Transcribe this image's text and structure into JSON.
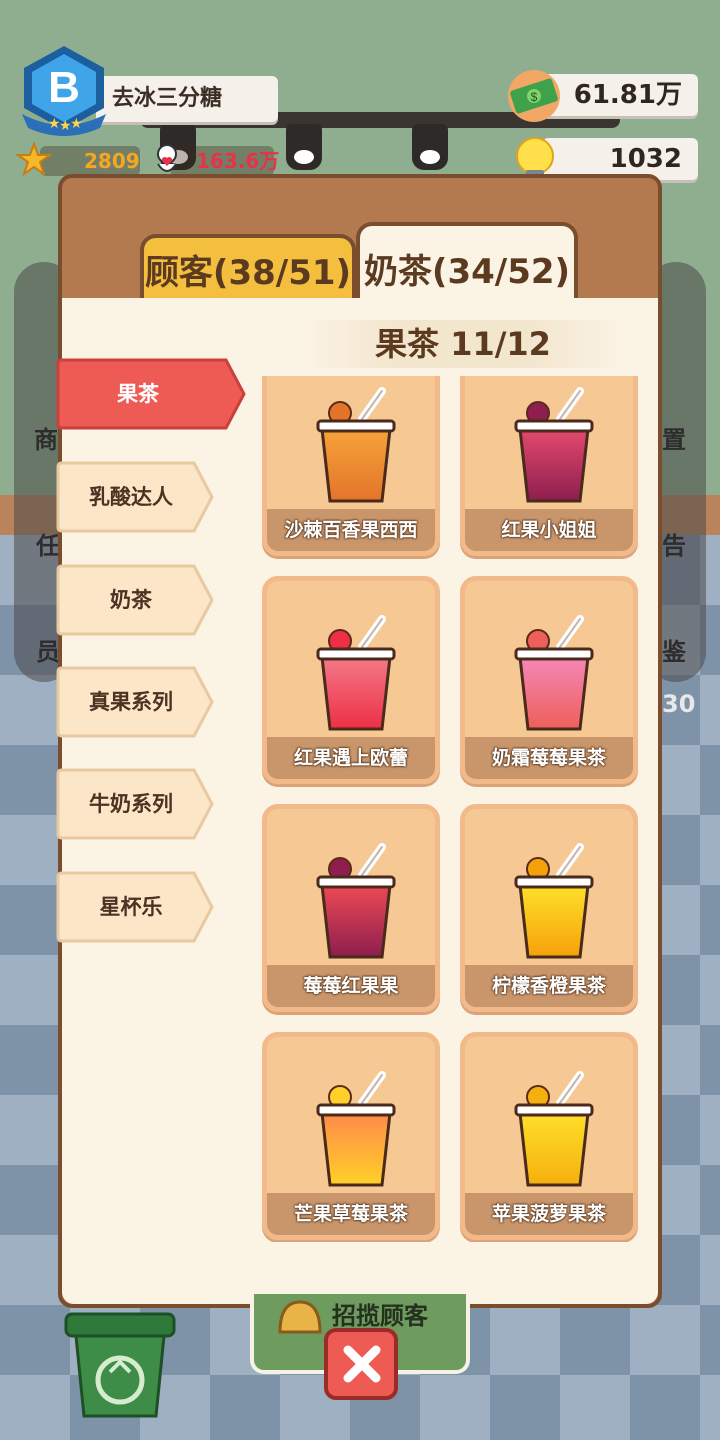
{
  "player": {
    "rank": "B",
    "name": "去冰三分糖",
    "stars": "2809",
    "popularity": "163.6万"
  },
  "currency": {
    "money": "61.81万",
    "ideas": "1032"
  },
  "side_menu_left": [
    "商",
    "任",
    "员"
  ],
  "side_menu_right": [
    "置",
    "告",
    "鉴"
  ],
  "floor_number": "30",
  "banner_text": "招揽顾客",
  "tabs": [
    {
      "label": "顾客(38/51)",
      "active": false
    },
    {
      "label": "奶茶(34/52)",
      "active": true
    }
  ],
  "category_header": "果茶 11/12",
  "categories": [
    {
      "label": "果茶",
      "active": true
    },
    {
      "label": "乳酸达人",
      "active": false
    },
    {
      "label": "奶茶",
      "active": false
    },
    {
      "label": "真果系列",
      "active": false
    },
    {
      "label": "牛奶系列",
      "active": false
    },
    {
      "label": "星杯乐",
      "active": false
    }
  ],
  "drinks": [
    {
      "name": "沙棘百香果西西",
      "icon": "seabuckthorn-drink-icon",
      "color_top": "#f6a33a",
      "color_bottom": "#e3742a"
    },
    {
      "name": "红果小姐姐",
      "icon": "red-fruit-drink-icon",
      "color_top": "#e34a6e",
      "color_bottom": "#8d1e4e"
    },
    {
      "name": "红果遇上欧蕾",
      "icon": "red-fruit-ole-drink-icon",
      "color_top": "#f27a88",
      "color_bottom": "#ee2f45"
    },
    {
      "name": "奶霜莓莓果茶",
      "icon": "cream-berry-drink-icon",
      "color_top": "#f588b8",
      "color_bottom": "#ee5f5a"
    },
    {
      "name": "莓莓红果果",
      "icon": "berry-red-fruit-drink-icon",
      "color_top": "#ee4a55",
      "color_bottom": "#8d1e4e"
    },
    {
      "name": "柠檬香橙果茶",
      "icon": "lemon-orange-drink-icon",
      "color_top": "#ffe02a",
      "color_bottom": "#f5a10a"
    },
    {
      "name": "芒果草莓果茶",
      "icon": "mango-strawberry-drink-icon",
      "color_top": "#ff8a4a",
      "color_bottom": "#ffd028"
    },
    {
      "name": "苹果菠萝果茶",
      "icon": "apple-pineapple-drink-icon",
      "color_top": "#ffdf2a",
      "color_bottom": "#f5b00e"
    }
  ],
  "colors": {
    "active_category": "#ee5b55",
    "inactive_category": "#fbe6c8",
    "tab_customers": "#f4bf3e"
  }
}
